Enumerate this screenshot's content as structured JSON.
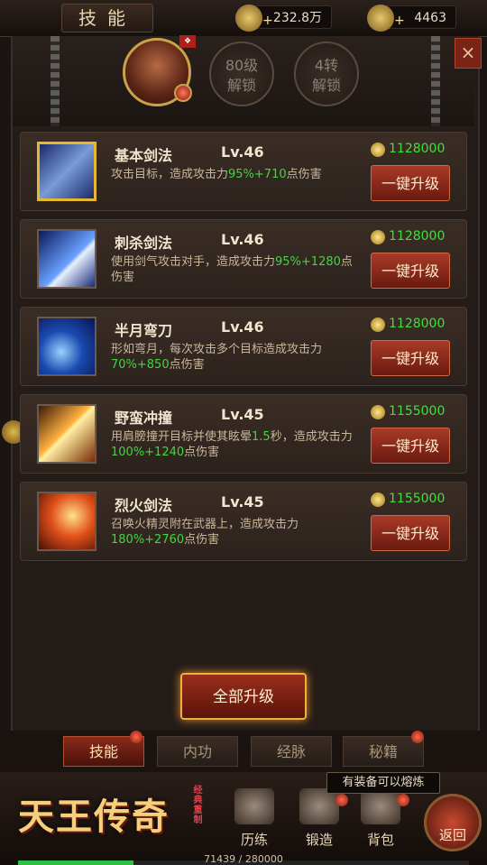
{
  "header": {
    "title": "技能",
    "gold": "232.8万",
    "ingot": "4463"
  },
  "unlocks": [
    {
      "line1": "80级",
      "line2": "解锁"
    },
    {
      "line1": "4转",
      "line2": "解锁"
    }
  ],
  "close_label": "×",
  "skills": [
    {
      "name": "基本剑法",
      "level": "Lv.46",
      "cost": "1128000",
      "button": "一键升级",
      "desc_pre": "攻击目标，造成攻击力",
      "desc_val": "95%+710",
      "desc_post": "点伤害"
    },
    {
      "name": "刺杀剑法",
      "level": "Lv.46",
      "cost": "1128000",
      "button": "一键升级",
      "desc_pre": "使用剑气攻击对手，造成攻击力",
      "desc_val": "95%+1280",
      "desc_post": "点伤害"
    },
    {
      "name": "半月弯刀",
      "level": "Lv.46",
      "cost": "1128000",
      "button": "一键升级",
      "desc_pre": "形如弯月，每次攻击多个目标造成攻击力",
      "desc_val": "70%+850",
      "desc_post": "点伤害"
    },
    {
      "name": "野蛮冲撞",
      "level": "Lv.45",
      "cost": "1155000",
      "button": "一键升级",
      "desc_pre": "用肩膀撞开目标并使其眩晕",
      "desc_val": "1.5",
      "desc_mid": "秒，造成攻击力",
      "desc_val2": "100%+1240",
      "desc_post": "点伤害"
    },
    {
      "name": "烈火剑法",
      "level": "Lv.45",
      "cost": "1155000",
      "button": "一键升级",
      "desc_pre": "召唤火精灵附在武器上，造成攻击力",
      "desc_val": "180%+2760",
      "desc_post": "点伤害"
    }
  ],
  "upgrade_all": "全部升级",
  "tabs": [
    "技能",
    "内功",
    "经脉",
    "秘籍"
  ],
  "logo": {
    "title": "天王传奇",
    "sub": "经典重制"
  },
  "nav": [
    "历练",
    "锻造",
    "背包"
  ],
  "tooltip": "有装备可以熔炼",
  "return_label": "返回",
  "exp": {
    "text": "71439 / 280000",
    "fraction": 0.255
  },
  "colors": {
    "accent_green": "#3ed83e",
    "gold_border": "#e6b830",
    "button_red": "#a83a28"
  }
}
